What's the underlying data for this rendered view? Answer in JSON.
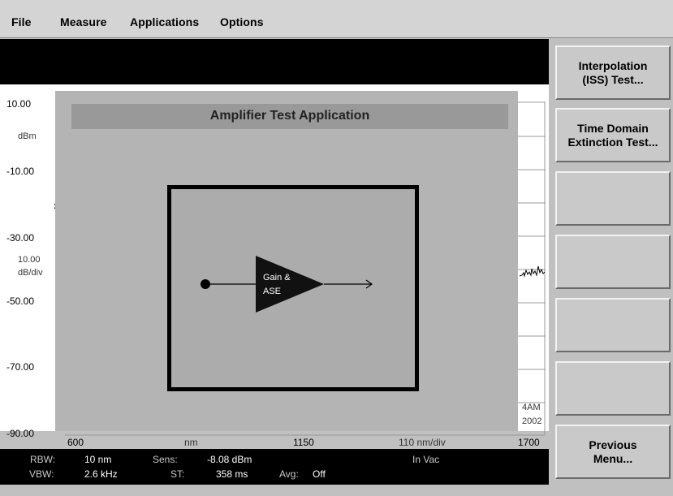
{
  "menu": {
    "file": "File",
    "measure": "Measure",
    "applications": "Applications",
    "options": "Options"
  },
  "plot": {
    "y_ticks": [
      "10.00",
      "-10.00",
      "-30.00",
      "-50.00",
      "-70.00",
      "-90.00"
    ],
    "y_unit": "dBm",
    "scale": "10.00",
    "scale_unit": "dB/div",
    "x_start": "600",
    "x_unit": "nm",
    "x_center": "1150",
    "x_span_per_div": "110 nm/div",
    "x_stop": "1700",
    "time_fragment": "4AM",
    "year_fragment": "2002",
    "marker_glyph": "»"
  },
  "status": {
    "rbw_label": "RBW:",
    "rbw_value": "10 nm",
    "sens_label": "Sens:",
    "sens_value": "-8.08 dBm",
    "medium": "In Vac",
    "vbw_label": "VBW:",
    "vbw_value": "2.6 kHz",
    "st_label": "ST:",
    "st_value": "358 ms",
    "avg_label": "Avg:",
    "avg_value": "Off"
  },
  "dialog": {
    "title": "Amplifier Test Application",
    "block_line1": "Gain &",
    "block_line2": "ASE"
  },
  "softkeys": {
    "key1": "Interpolation\n(ISS) Test...",
    "key2": "Time Domain\nExtinction Test...",
    "key3": "",
    "key4": "",
    "key5": "",
    "key6": "",
    "key7": "Previous\nMenu..."
  }
}
